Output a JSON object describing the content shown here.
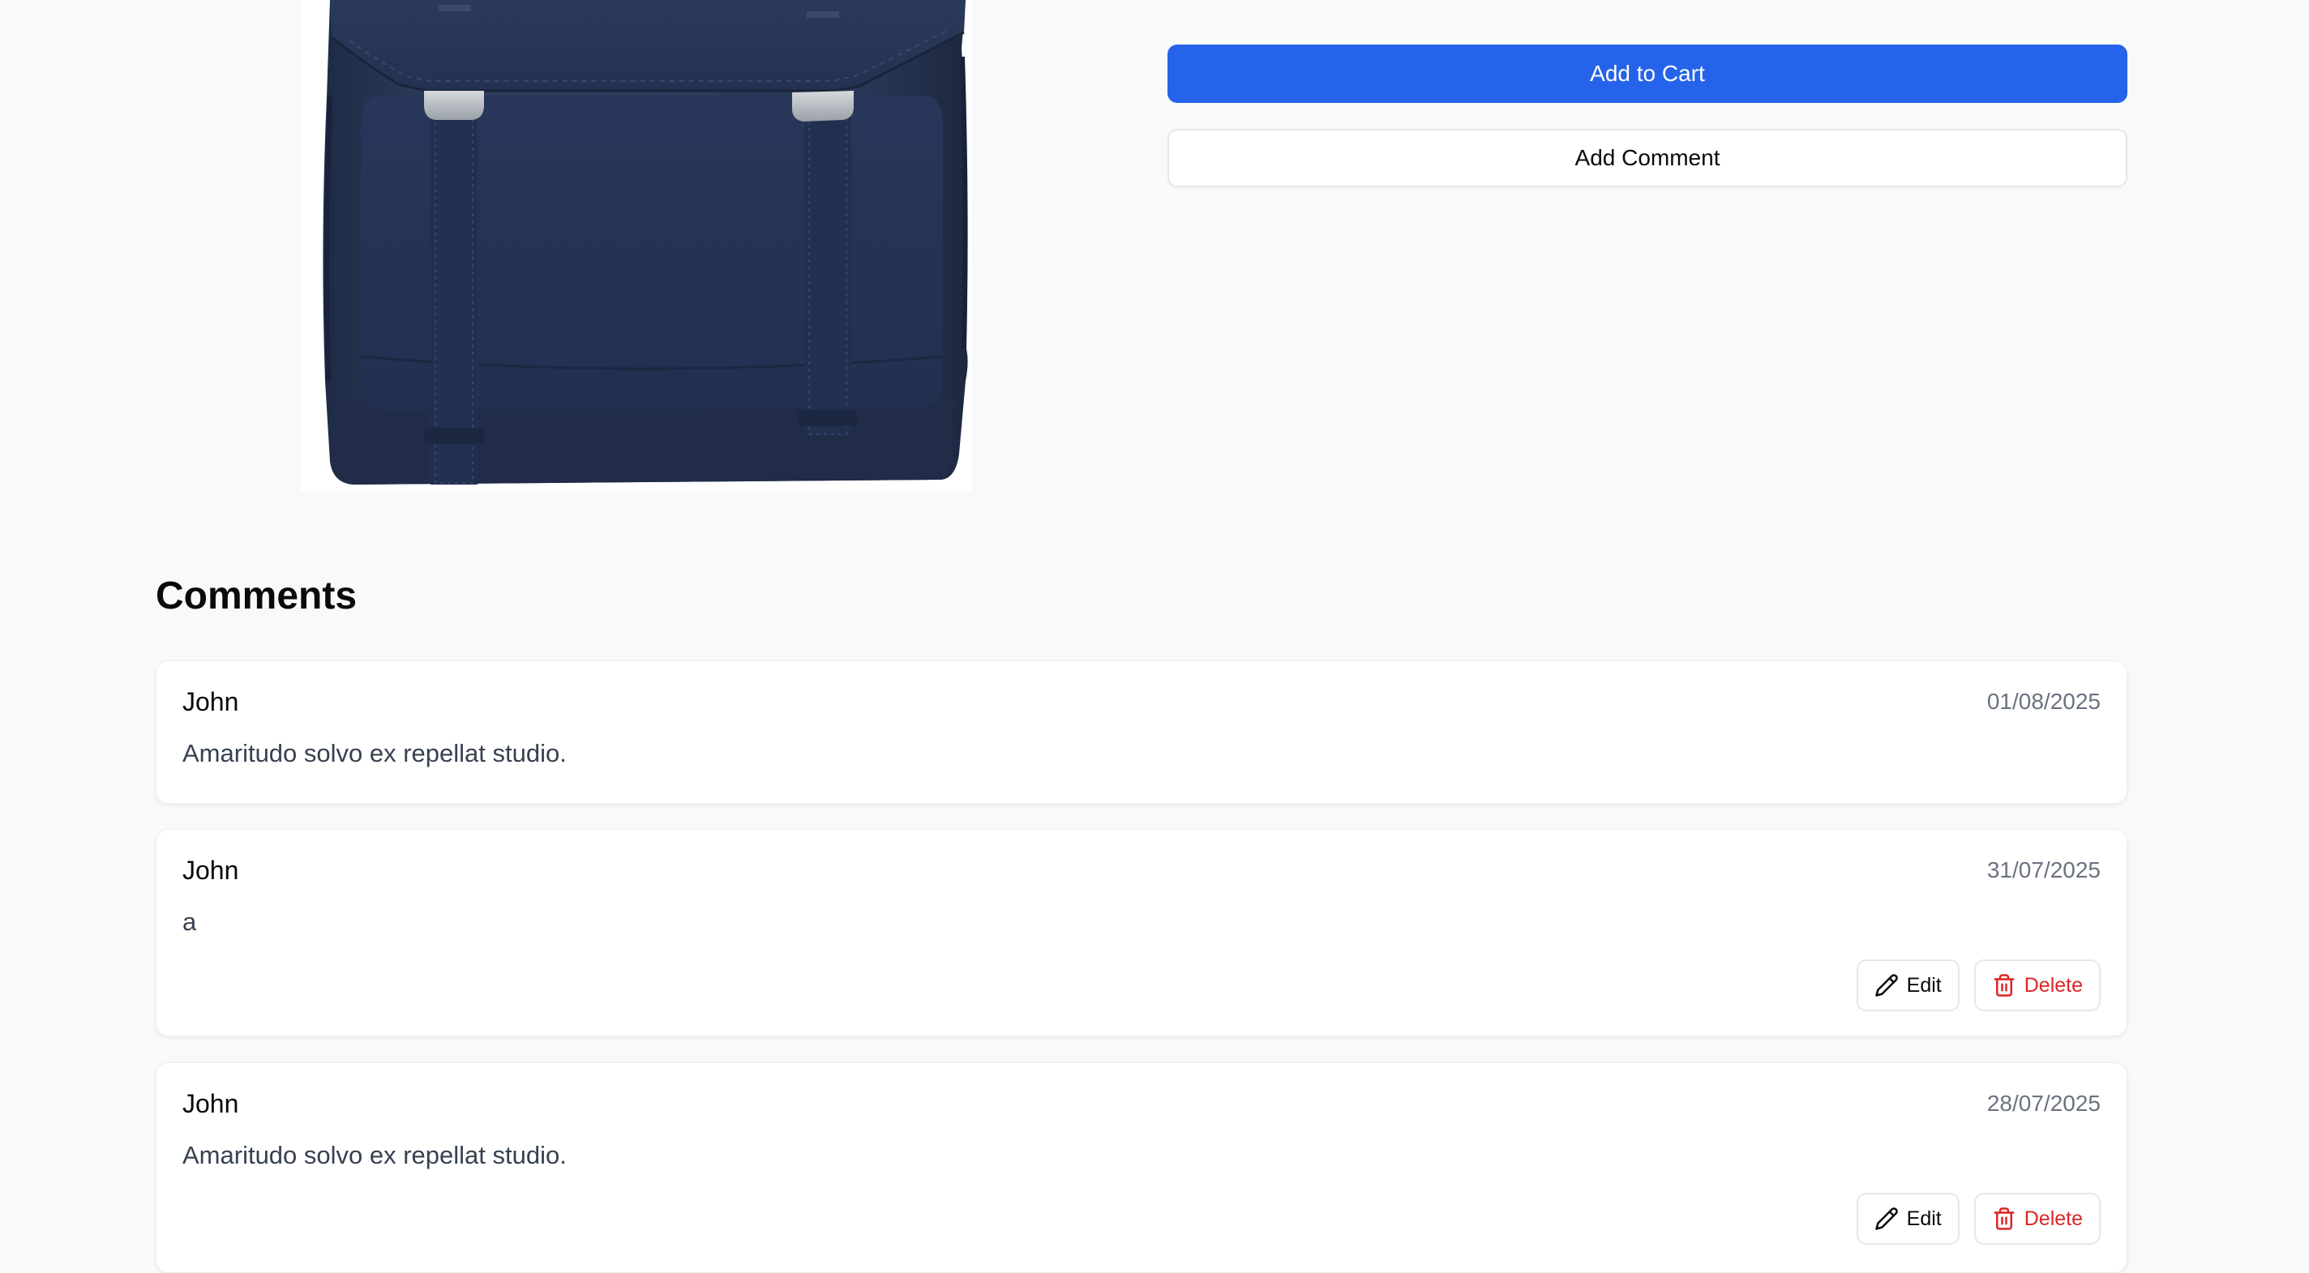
{
  "product": {
    "image_alt": "navy-backpack-image"
  },
  "actions": {
    "add_to_cart_label": "Add to Cart",
    "add_comment_label": "Add Comment"
  },
  "comments": {
    "heading": "Comments",
    "items": [
      {
        "author": "John",
        "date": "01/08/2025",
        "text": "Amaritudo solvo ex repellat studio.",
        "editable": false
      },
      {
        "author": "John",
        "date": "31/07/2025",
        "text": "a",
        "editable": true,
        "edit_label": "Edit",
        "delete_label": "Delete"
      },
      {
        "author": "John",
        "date": "28/07/2025",
        "text": "Amaritudo solvo ex repellat studio.",
        "editable": true,
        "edit_label": "Edit",
        "delete_label": "Delete"
      }
    ]
  },
  "colors": {
    "page_background": "#f8f9fb",
    "primary": "#2563eb",
    "danger": "#dc2626",
    "muted_text": "#6b7280",
    "backpack_navy": "#253351"
  },
  "icons": {
    "edit": "pencil-icon",
    "delete": "trash-icon"
  }
}
